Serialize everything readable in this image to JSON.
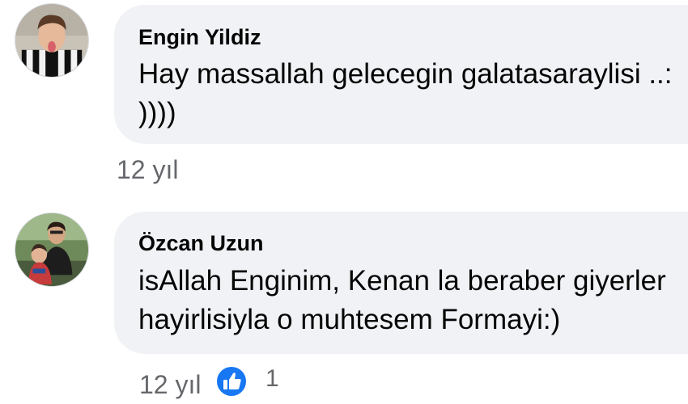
{
  "comments": [
    {
      "author": "Engin Yildiz",
      "lines": [
        "Hay massallah gelecegin galatasaraylisi ..:",
        "))))"
      ],
      "timestamp": "12 yıl"
    },
    {
      "author": "Özcan Uzun",
      "lines": [
        "isAllah Enginim, Kenan la beraber giyerler",
        "hayirlisiyla o muhtesem Formayi:)"
      ],
      "timestamp": "12 yıl",
      "reaction": {
        "icon": "like-icon",
        "count": "1"
      }
    }
  ],
  "colors": {
    "bubble_bg": "#f0f2f5",
    "text": "#050505",
    "meta": "#65676b",
    "like_blue": "#1877f2"
  }
}
